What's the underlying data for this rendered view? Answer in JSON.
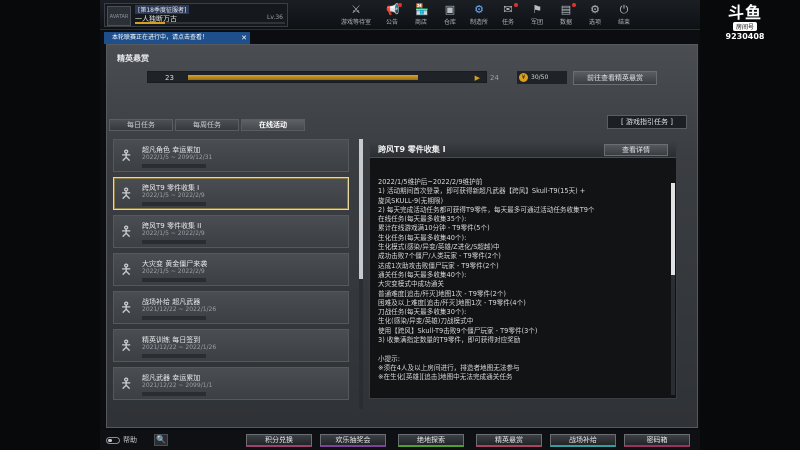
{
  "profile": {
    "rank": "[第18季度征服者]",
    "nickname": "一人独断万古",
    "level": "Lv.36",
    "avatar_text": "AVATAR"
  },
  "menu": [
    {
      "label": "游戏等待室",
      "icon": "swords-icon",
      "glyph": "⚔"
    },
    {
      "label": "公告",
      "icon": "megaphone-icon",
      "glyph": "📢"
    },
    {
      "label": "商店",
      "icon": "shop-icon",
      "glyph": "🏪"
    },
    {
      "label": "仓库",
      "icon": "warehouse-icon",
      "glyph": "▣"
    },
    {
      "label": "制造所",
      "icon": "factory-icon",
      "glyph": "⚙"
    },
    {
      "label": "任务",
      "icon": "mission-icon",
      "glyph": "✉"
    },
    {
      "label": "军团",
      "icon": "clan-icon",
      "glyph": "⚑"
    },
    {
      "label": "数据",
      "icon": "data-icon",
      "glyph": "▤"
    },
    {
      "label": "选项",
      "icon": "options-icon",
      "glyph": "⚙"
    },
    {
      "label": "结束",
      "icon": "power-icon",
      "glyph": "⏻"
    }
  ],
  "ticker": {
    "text": "本轮联赛正在进行中，请点击查看！",
    "close": "✕"
  },
  "brand": {
    "logo": "斗鱼",
    "room_label": "房间号",
    "room_number": "9230408"
  },
  "panel": {
    "title": "精英悬赏",
    "progress": {
      "current": "23",
      "max": "24",
      "fraction": 0.9
    },
    "coins": "30/50",
    "coin_glyph": "¥",
    "goto_button": "前往查看精英悬赏"
  },
  "tabs": [
    "每日任务",
    "每周任务",
    "在线活动"
  ],
  "guide_button": "[ 游戏指引任务 ]",
  "list": [
    {
      "name": "超凡角色 幸运累加",
      "date": "2022/1/5 ~ 2099/12/31",
      "progress": 0.0
    },
    {
      "name": "跨风T9 零件收集 I",
      "date": "2022/1/5 ~ 2022/2/9",
      "progress": 0.0
    },
    {
      "name": "跨风T9 零件收集 II",
      "date": "2022/1/5 ~ 2022/2/9",
      "progress": 0.0
    },
    {
      "name": "大灾变 黄金僵尸来袭",
      "date": "2022/1/5 ~ 2022/2/9",
      "progress": 0.0
    },
    {
      "name": "战场补给 超凡武器",
      "date": "2021/12/22 ~ 2022/1/26",
      "progress": 0.0
    },
    {
      "name": "精英训练 每日签到",
      "date": "2021/12/22 ~ 2022/1/26",
      "progress": 0.0
    },
    {
      "name": "超凡武器 幸运累加",
      "date": "2021/12/22 ~ 2099/1/1",
      "progress": 0.0
    }
  ],
  "detail": {
    "title": "跨风T9 零件收集 I",
    "button": "查看详情",
    "lines": [
      "2022/1/5维护后~2022/2/9维护前",
      "1) 活动期间首次登录，即可获得新超凡武器【跨风】Skull-T9(15天) +",
      "   旋风SKULL-9(无期限)",
      "2) 每天完成活动任务都可获得T9零件，每天最多可通过活动任务收集T9个",
      "   在线任务(每天最多收集35个):",
      "   累计在线游戏满10分钟 - T9零件(5个)",
      "   生化任务(每天最多收集40个):",
      "   生化模式(感染/异变/英雄/Z进化/S超越)中",
      "   成功击败7个僵尸/人类玩家 - T9零件(2个)",
      "   达成1次助攻击败僵尸玩家 - T9零件(2个)",
      "   通关任务(每天最多收集40个):",
      "   大灾变模式中成功通关",
      "   普通难度[追击/歼灭]地图1次 - T9零件(2个)",
      "   困难及以上难度[追击/歼灭]地图1次 - T9零件(4个)",
      "   刀战任务(每天最多收集30个):",
      "   生化(感染/异变/英雄)刀战模式中",
      "   使用【跨风】Skull-T9击败9个僵尸玩家 - T9零件(3个)",
      "3) 收集满指定数量的T9零件，即可获得对应奖励",
      "",
      "小提示:",
      "※须在4人及以上房间进行，排造者地图无法参与",
      "※在生化[英雄][追击]地图中无法完成通关任务"
    ]
  },
  "bottom": {
    "help": "帮助",
    "search_glyph": "🔍",
    "buttons": [
      {
        "label": "积分兑换",
        "color": "#a04070"
      },
      {
        "label": "欢乐抽奖会",
        "color": "#8040a0"
      },
      {
        "label": "绝地探索",
        "color": "#50a030"
      },
      {
        "label": "精英悬赏",
        "color": "#b04060"
      },
      {
        "label": "战场补给",
        "color": "#30a0a0"
      },
      {
        "label": "密码箱",
        "color": "#a03060"
      }
    ]
  }
}
